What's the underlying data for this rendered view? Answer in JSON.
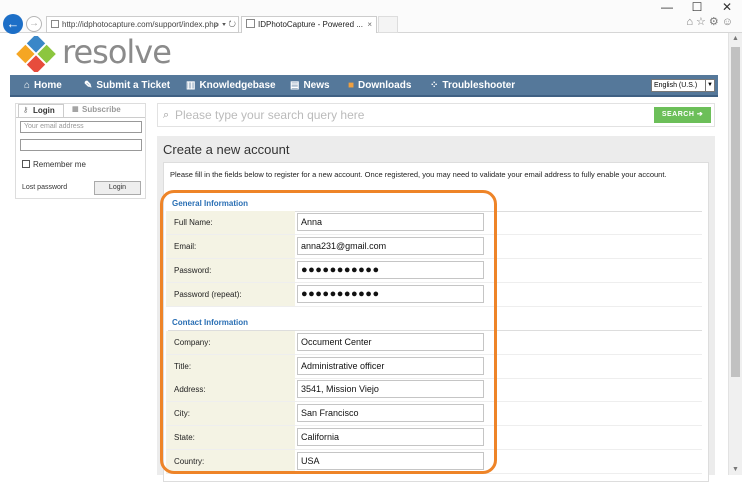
{
  "browser": {
    "url": "http://idphotocapture.com/support/index.php",
    "tab_title": "IDPhotoCapture - Powered ...",
    "min": "—",
    "max": "☐",
    "close": "✕"
  },
  "site": {
    "logo_text": "resolve"
  },
  "nav": {
    "items": [
      {
        "label": "Home",
        "icon": "home-icon"
      },
      {
        "label": "Submit a Ticket",
        "icon": "pencil-icon"
      },
      {
        "label": "Knowledgebase",
        "icon": "book-icon"
      },
      {
        "label": "News",
        "icon": "news-icon"
      },
      {
        "label": "Downloads",
        "icon": "download-icon"
      },
      {
        "label": "Troubleshooter",
        "icon": "troubleshooter-icon"
      }
    ],
    "language": "English (U.S.)"
  },
  "login": {
    "tab_login": "Login",
    "tab_subscribe": "Subscribe",
    "email_placeholder": "Your email address",
    "remember": "Remember me",
    "lost_password": "Lost password",
    "button": "Login"
  },
  "search": {
    "placeholder": "Please type your search query here",
    "button": "SEARCH"
  },
  "form": {
    "title": "Create a new account",
    "intro": "Please fill in the fields below to register for a new account. Once registered, you may need to validate your email address to fully enable your account.",
    "general_heading": "General Information",
    "general_fields": [
      {
        "label": "Full Name:",
        "value": "Anna"
      },
      {
        "label": "Email:",
        "value": "anna231@gmail.com"
      },
      {
        "label": "Password:",
        "value": "●●●●●●●●●●●"
      },
      {
        "label": "Password (repeat):",
        "value": "●●●●●●●●●●●"
      }
    ],
    "contact_heading": "Contact Information",
    "contact_fields": [
      {
        "label": "Company:",
        "value": "Occument Center"
      },
      {
        "label": "Title:",
        "value": "Administrative officer"
      },
      {
        "label": "Address:",
        "value": "3541, Mission Viejo"
      },
      {
        "label": "City:",
        "value": "San Francisco"
      },
      {
        "label": "State:",
        "value": "California"
      },
      {
        "label": "Country:",
        "value": "USA"
      }
    ]
  },
  "colors": {
    "nav_bg": "#55789a",
    "accent_blue": "#2a6fb4",
    "search_green": "#6cbf59",
    "highlight_orange": "#ee8428",
    "label_bg": "#f4f3e4"
  }
}
